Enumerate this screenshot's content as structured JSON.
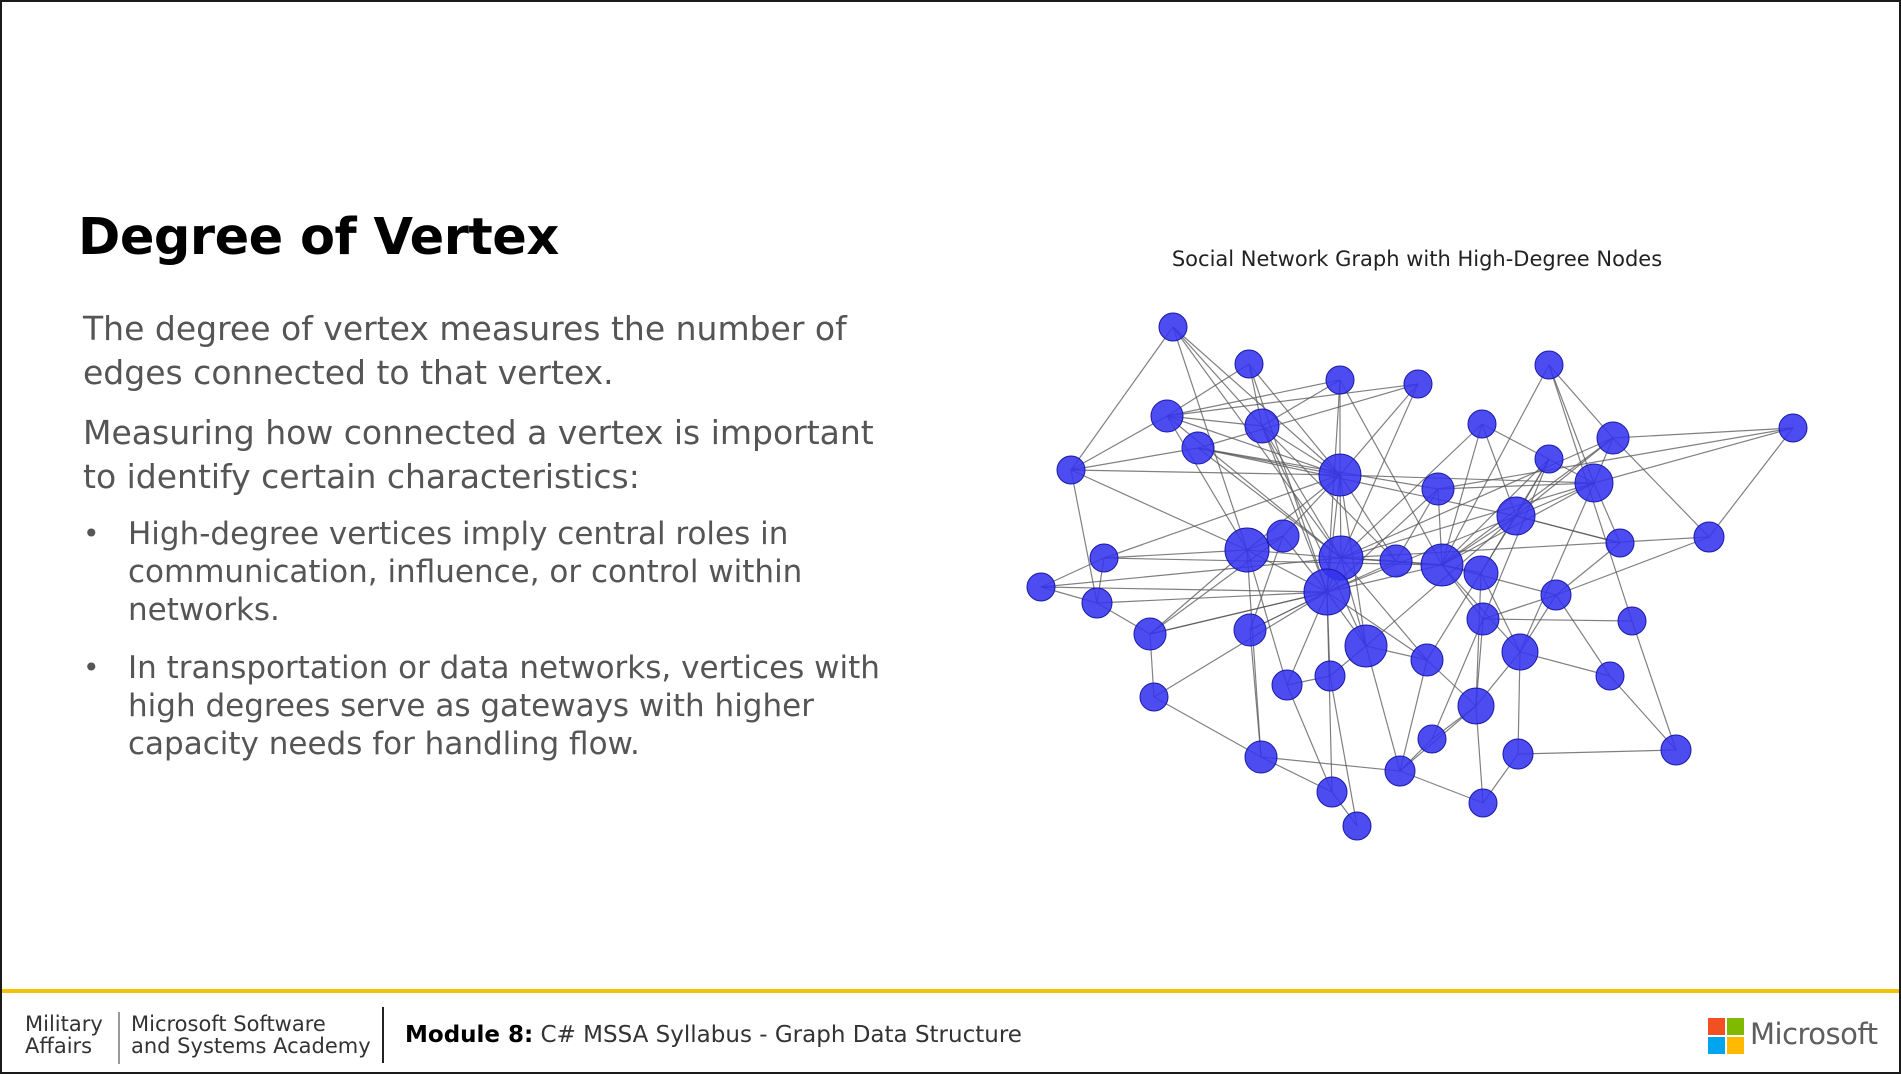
{
  "slide": {
    "title": "Degree of Vertex",
    "paragraphs": [
      "The degree of vertex measures the number of edges connected to that vertex.",
      "Measuring how connected a vertex is important to identify certain characteristics:"
    ],
    "bullets": [
      "High-degree vertices imply central roles in communication, influence, or control within networks.",
      "In transportation or data networks, vertices with high degrees serve as gateways with higher capacity needs for handling flow."
    ],
    "bullet_symbol": "•"
  },
  "graph": {
    "title": "Social Network Graph with High-Degree Nodes",
    "node_color": "#3333ee",
    "edge_color": "#555555",
    "node_count": 56
  },
  "footer": {
    "org_line1": "Military",
    "org_line2": "Affairs",
    "academy_line1": "Microsoft Software",
    "academy_line2": "and Systems Academy",
    "module_label": "Module 8:",
    "module_text": " C# MSSA Syllabus - Graph Data Structure",
    "brand": "Microsoft",
    "accent_color": "#f2c300",
    "logo_colors": [
      "#f25022",
      "#7fba00",
      "#00a4ef",
      "#ffb900"
    ]
  }
}
